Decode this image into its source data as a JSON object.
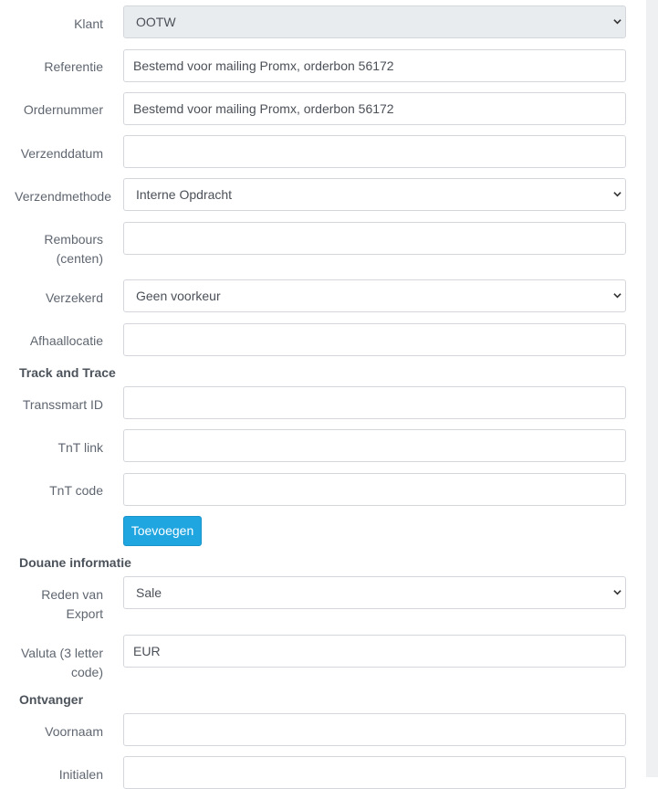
{
  "form": {
    "klant": {
      "label": "Klant",
      "value": "OOTW"
    },
    "referentie": {
      "label": "Referentie",
      "value": "Bestemd voor mailing Promx, orderbon 56172"
    },
    "ordernummer": {
      "label": "Ordernummer",
      "value": "Bestemd voor mailing Promx, orderbon 56172"
    },
    "verzenddatum": {
      "label": "Verzenddatum",
      "value": ""
    },
    "verzendmethode": {
      "label": "Verzendmethode",
      "value": "Interne Opdracht"
    },
    "rembours": {
      "label_line1": "Rembours",
      "label_line2": "(centen)",
      "value": ""
    },
    "verzekerd": {
      "label": "Verzekerd",
      "value": "Geen voorkeur"
    },
    "afhaallocatie": {
      "label": "Afhaallocatie",
      "value": ""
    }
  },
  "track_and_trace": {
    "heading": "Track and Trace",
    "transsmart_id": {
      "label": "Transsmart ID",
      "value": ""
    },
    "tnt_link": {
      "label": "TnT link",
      "value": ""
    },
    "tnt_code": {
      "label": "TnT code",
      "value": ""
    },
    "add_button": "Toevoegen"
  },
  "douane": {
    "heading": "Douane informatie",
    "reden": {
      "label_line1": "Reden van",
      "label_line2": "Export",
      "value": "Sale"
    },
    "valuta": {
      "label_line1": "Valuta (3 letter",
      "label_line2": "code)",
      "value": "EUR"
    }
  },
  "ontvanger": {
    "heading": "Ontvanger",
    "voornaam": {
      "label": "Voornaam",
      "value": ""
    },
    "initialen": {
      "label": "Initialen",
      "value": ""
    }
  },
  "icons": {
    "select_arrow": "chevron-down-icon"
  }
}
